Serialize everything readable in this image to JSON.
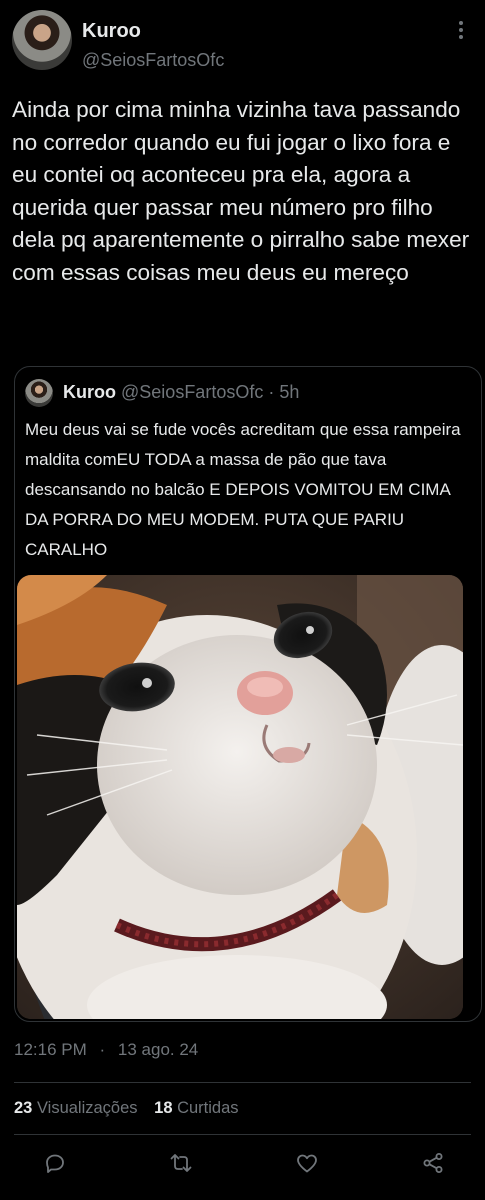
{
  "tweet": {
    "author_name": "Kuroo",
    "author_handle": "@SeiosFartosOfc",
    "text": "Ainda por cima minha vizinha tava passando no corredor quando eu fui jogar o lixo fora e eu contei oq aconteceu pra ela, agora a querida quer passar meu número pro filho dela pq aparentemente o pirralho sabe mexer com essas coisas meu deus eu mereço"
  },
  "quoted": {
    "author_name": "Kuroo",
    "author_handle": "@SeiosFartosOfc",
    "separator": "·",
    "time": "5h",
    "text": "Meu deus vai se fude vocês acreditam que essa rampeira maldita comEU TODA  a  massa de pão que tava descansando no balcão  E DEPOIS VOMITOU EM CIMA DA PORRA DO MEU  MODEM. PUTA QUE PARIU  CARALHO"
  },
  "meta": {
    "time": "12:16 PM",
    "separator": "·",
    "date": "13 ago. 24"
  },
  "stats": {
    "views_count": "23",
    "views_label": "Visualizações",
    "reposts_count": "18",
    "reposts_label": "Curtidas"
  },
  "icons": {
    "more": "more-vertical-icon",
    "reply": "reply-icon",
    "retweet": "retweet-icon",
    "like": "heart-icon",
    "share": "share-icon"
  },
  "colors": {
    "background": "#000000",
    "text": "#e7e9ea",
    "secondary": "#71767b",
    "border": "#2f3336"
  }
}
